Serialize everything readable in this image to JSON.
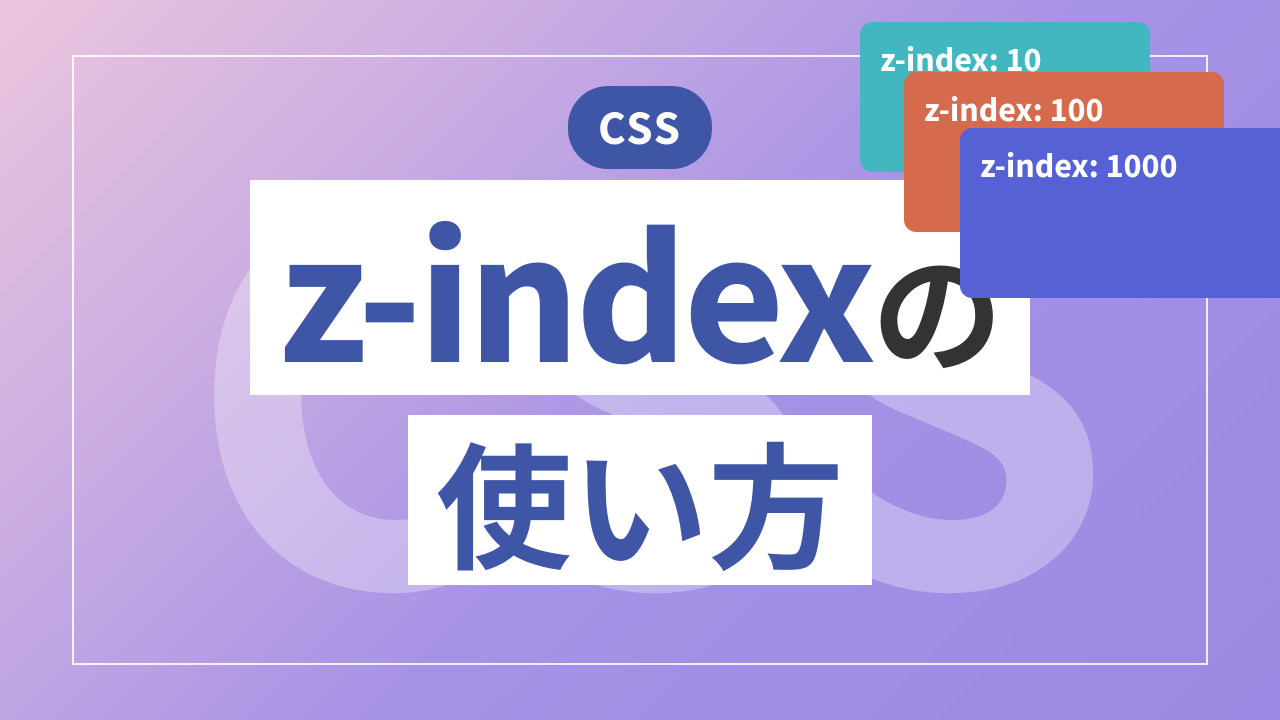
{
  "background_text": "CSS",
  "badge": "CSS",
  "title": {
    "line1_main": "z-index",
    "line1_sub": "の",
    "line2": "使い方"
  },
  "cards": {
    "c1": "z-index: 10",
    "c2": "z-index: 100",
    "c3": "z-index: 1000"
  },
  "colors": {
    "brand": "#3f56a6",
    "card_teal": "#43b7c0",
    "card_orange": "#d56b4c",
    "card_indigo": "#5561d4"
  }
}
